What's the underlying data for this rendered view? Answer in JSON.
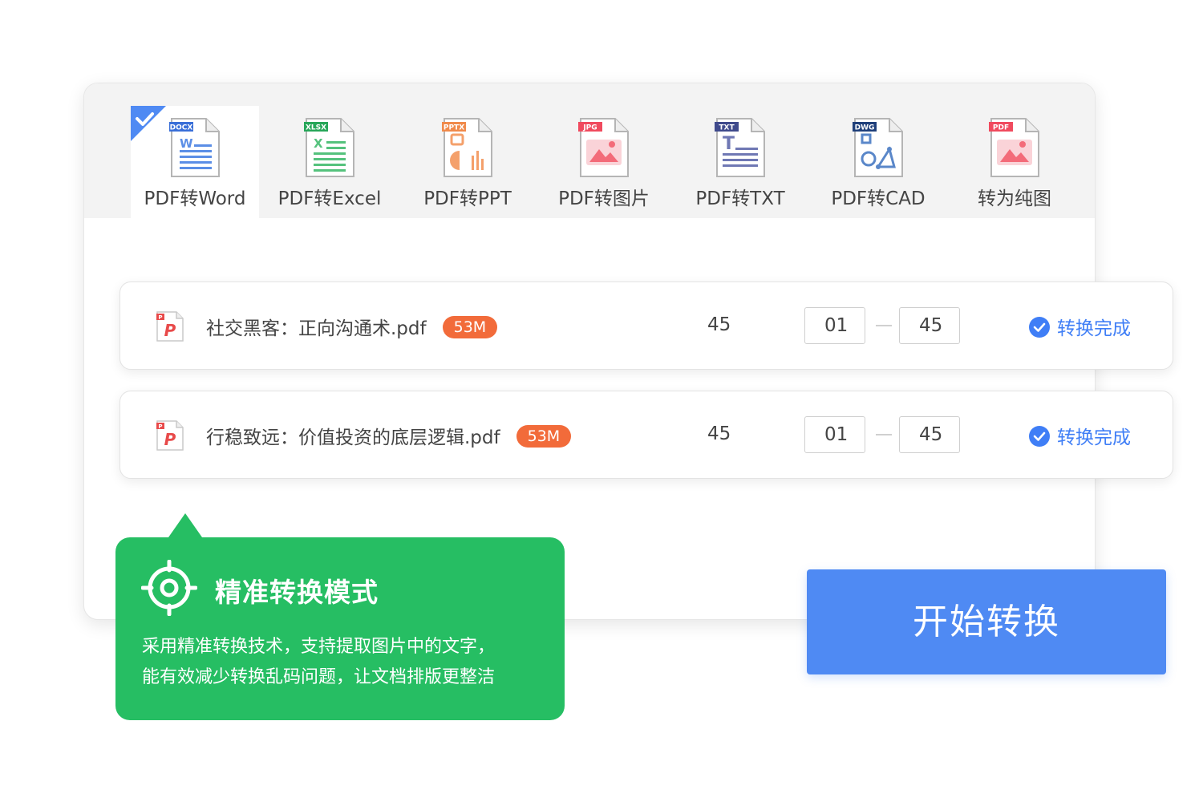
{
  "tabs": [
    {
      "label": "PDF转Word",
      "badge": "DOCX",
      "badge_color": "#3a6fd8",
      "accent": "#5b8ee6",
      "kind": "word",
      "active": true
    },
    {
      "label": "PDF转Excel",
      "badge": "XLSX",
      "badge_color": "#27a659",
      "accent": "#55c27d",
      "kind": "excel",
      "active": false
    },
    {
      "label": "PDF转PPT",
      "badge": "PPTX",
      "badge_color": "#f08a4b",
      "accent": "#f4a06b",
      "kind": "ppt",
      "active": false
    },
    {
      "label": "PDF转图片",
      "badge": "JPG",
      "badge_color": "#f04a5e",
      "accent": "#f36b79",
      "kind": "image",
      "active": false
    },
    {
      "label": "PDF转TXT",
      "badge": "TXT",
      "badge_color": "#3f4a8c",
      "accent": "#6f78b4",
      "kind": "txt",
      "active": false
    },
    {
      "label": "PDF转CAD",
      "badge": "DWG",
      "badge_color": "#1f3f7a",
      "accent": "#5a87c9",
      "kind": "cad",
      "active": false
    },
    {
      "label": "转为纯图",
      "badge": "PDF",
      "badge_color": "#f04a5e",
      "accent": "#f36b79",
      "kind": "image",
      "active": false
    }
  ],
  "files": [
    {
      "name": "社交黑客：正向沟通术.pdf",
      "size": "53M",
      "pages": "45",
      "from": "01",
      "to": "45",
      "status": "转换完成"
    },
    {
      "name": "行稳致远：价值投资的底层逻辑.pdf",
      "size": "53M",
      "pages": "45",
      "from": "01",
      "to": "45",
      "status": "转换完成"
    }
  ],
  "tip": {
    "title": "精准转换模式",
    "line1": "采用精准转换技术，支持提取图片中的文字，",
    "line2": "能有效减少转换乱码问题，让文档排版更整洁"
  },
  "start_button": "开始转换",
  "colors": {
    "accent_blue": "#4f8af3",
    "status_blue": "#3f7ef6",
    "tip_green": "#26be63",
    "size_orange": "#f26b3a"
  }
}
